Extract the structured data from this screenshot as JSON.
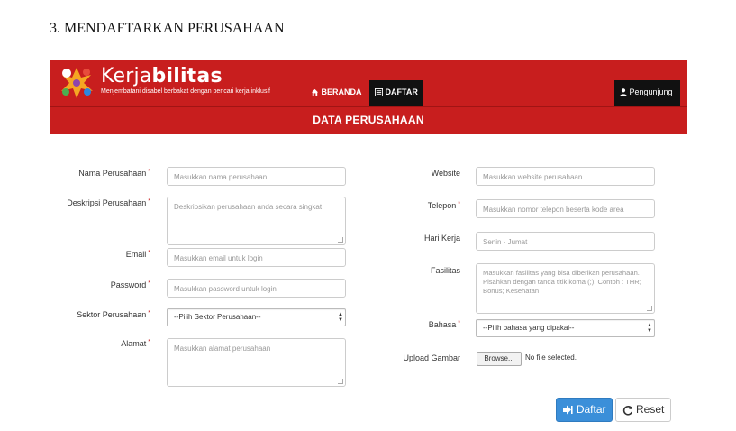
{
  "doc_heading": "3. MENDAFTARKAN PERUSAHAAN",
  "navbar": {
    "brand_light": "Kerja",
    "brand_bold": "bilitas",
    "tagline": "Menjembatani disabel berbakat dengan pencari kerja inklusif",
    "home_label": "BERANDA",
    "daftar_label": "DAFTAR",
    "user_label": "Pengunjung"
  },
  "section_title": "DATA PERUSAHAAN",
  "form": {
    "nama": {
      "label": "Nama Perusahaan",
      "placeholder": "Masukkan nama perusahaan"
    },
    "deskripsi": {
      "label": "Deskripsi Perusahaan",
      "placeholder": "Deskripsikan perusahaan anda secara singkat"
    },
    "email": {
      "label": "Email",
      "placeholder": "Masukkan email untuk login"
    },
    "password": {
      "label": "Password",
      "placeholder": "Masukkan password untuk login"
    },
    "sektor": {
      "label": "Sektor Perusahaan",
      "selected": "--Pilih Sektor Perusahaan--"
    },
    "alamat": {
      "label": "Alamat",
      "placeholder": "Masukkan alamat perusahaan"
    },
    "website": {
      "label": "Website",
      "placeholder": "Masukkan website perusahaan"
    },
    "telepon": {
      "label": "Telepon",
      "placeholder": "Masukkan nomor telepon beserta kode area"
    },
    "hari_kerja": {
      "label": "Hari Kerja",
      "placeholder": "Senin - Jumat"
    },
    "fasilitas": {
      "label": "Fasilitas",
      "placeholder": "Masukkan fasilitas yang bisa diberikan perusahaan. Pisahkan dengan tanda titik koma (;). Contoh : THR; Bonus; Kesehatan"
    },
    "bahasa": {
      "label": "Bahasa",
      "selected": "--Pilih bahasa yang dipakai--"
    },
    "upload": {
      "label": "Upload Gambar",
      "browse_label": "Browse...",
      "status": "No file selected."
    },
    "required_mark": "*"
  },
  "buttons": {
    "submit": "Daftar",
    "reset": "Reset"
  },
  "colors": {
    "brand_red": "#c81e1e",
    "nav_dark": "#111111",
    "primary_blue": "#3b8fd9"
  }
}
